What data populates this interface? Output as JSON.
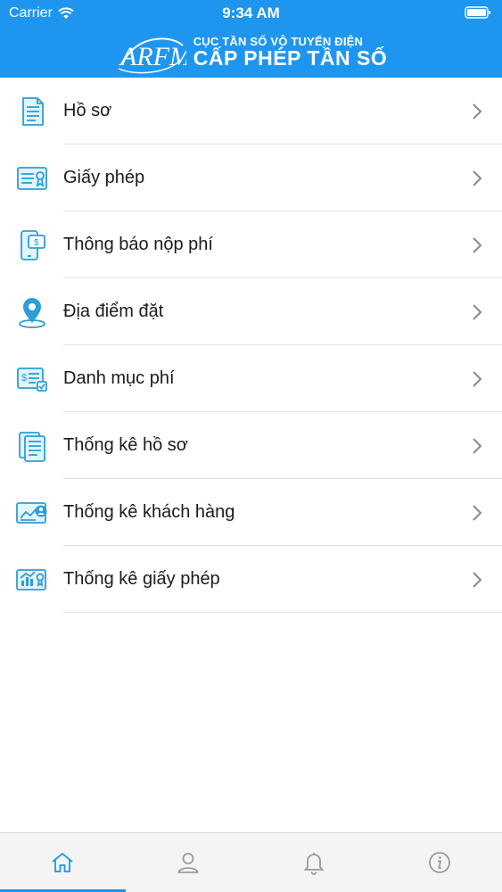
{
  "status_bar": {
    "carrier": "Carrier",
    "time": "9:34 AM"
  },
  "header": {
    "logo_text": "ARFM",
    "subtitle": "CỤC TẦN SỐ VÔ TUYẾN ĐIỆN",
    "title": "CẤP PHÉP TẦN SỐ"
  },
  "menu": {
    "items": [
      {
        "label": "Hồ sơ",
        "icon": "document-icon"
      },
      {
        "label": "Giấy phép",
        "icon": "license-icon"
      },
      {
        "label": "Thông báo nộp phí",
        "icon": "phone-payment-icon"
      },
      {
        "label": "Địa điểm đặt",
        "icon": "location-pin-icon"
      },
      {
        "label": "Danh mục phí",
        "icon": "fee-list-icon"
      },
      {
        "label": "Thống kê hồ sơ",
        "icon": "documents-stats-icon"
      },
      {
        "label": "Thống kê khách hàng",
        "icon": "customer-stats-icon"
      },
      {
        "label": "Thống kê giấy phép",
        "icon": "license-stats-icon"
      }
    ]
  },
  "tabbar": {
    "active": "home",
    "tabs": [
      {
        "id": "home",
        "icon": "home-icon"
      },
      {
        "id": "profile",
        "icon": "user-icon"
      },
      {
        "id": "notifications",
        "icon": "bell-icon"
      },
      {
        "id": "info",
        "icon": "info-icon"
      }
    ]
  },
  "colors": {
    "brand": "#1e96f0",
    "icon": "#2a9fd8",
    "tab_icon": "#9a9a9a",
    "tab_active": "#1e96f0"
  }
}
